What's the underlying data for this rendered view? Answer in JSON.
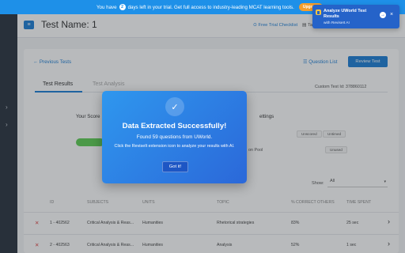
{
  "banner": {
    "text_before": "You have",
    "days": "2",
    "text_after": "days left in your trial. Get full access to industry-leading MCAT learning tools.",
    "upgrade_label": "Upgrade"
  },
  "extension_popup": {
    "title": "Analyze UWorld Test Results",
    "subtitle": "with ReviseIt AI",
    "arrow": "→",
    "close": "×"
  },
  "sidebar": {
    "chevron_1": "›",
    "chevron_2": "›"
  },
  "header": {
    "menu_icon": "≡",
    "test_name": "Test Name: 1",
    "checklist_label": "Free Trial Checklist",
    "checklist_icon": "⊙",
    "tab_label": "Ta"
  },
  "top_actions": {
    "previous_tests": "Previous Tests",
    "back_arrow": "←",
    "question_list": "Question List",
    "list_icon": "☰",
    "review_test": "Review Test"
  },
  "tabs": {
    "results": "Test Results",
    "analysis": "Test Analysis"
  },
  "custom_test_id": "Custom Test Id: 378860112",
  "score": {
    "label": "Your Score",
    "bar_fraction": 0.55
  },
  "settings": {
    "label": "ettings",
    "pill_unused_1": "Unscored",
    "pill_untimed": "Untimed",
    "pool_label": "on Pool",
    "pill_unused_2": "Unused"
  },
  "show": {
    "label": "Show:",
    "value": "All",
    "caret": "▾"
  },
  "table": {
    "headers": {
      "id": "ID",
      "subjects": "SUBJECTS",
      "units": "UNITS",
      "topic": "TOPIC",
      "correct": "% CORRECT OTHERS",
      "time": "TIME SPENT"
    },
    "rows": [
      {
        "status": "✕",
        "id": "1 - 402562",
        "subject": "Critical Analysis & Reas...",
        "unit": "Humanities",
        "topic": "Rhetorical strategies",
        "correct": "83%",
        "time": "25 sec",
        "arrow": "›"
      },
      {
        "status": "✕",
        "id": "2 - 402563",
        "subject": "Critical Analysis & Reas...",
        "unit": "Humanities",
        "topic": "Analysis",
        "correct": "52%",
        "time": "1 sec",
        "arrow": "›"
      }
    ]
  },
  "modal": {
    "check_icon": "✓",
    "title": "Data Extracted Successfully!",
    "line1": "Found 59 questions from UWorld.",
    "line2": "Click the ReviseIt extension icon to analyze your results with AI.",
    "button": "Got it!"
  },
  "colors": {
    "banner": "#1e90e8",
    "accent": "#1e7fd6",
    "sidebar": "#2c3440",
    "score_bar": "#5fcf55",
    "modal_start": "#2f97ee",
    "modal_end": "#2b68d9",
    "upgrade": "#f59e2b"
  }
}
